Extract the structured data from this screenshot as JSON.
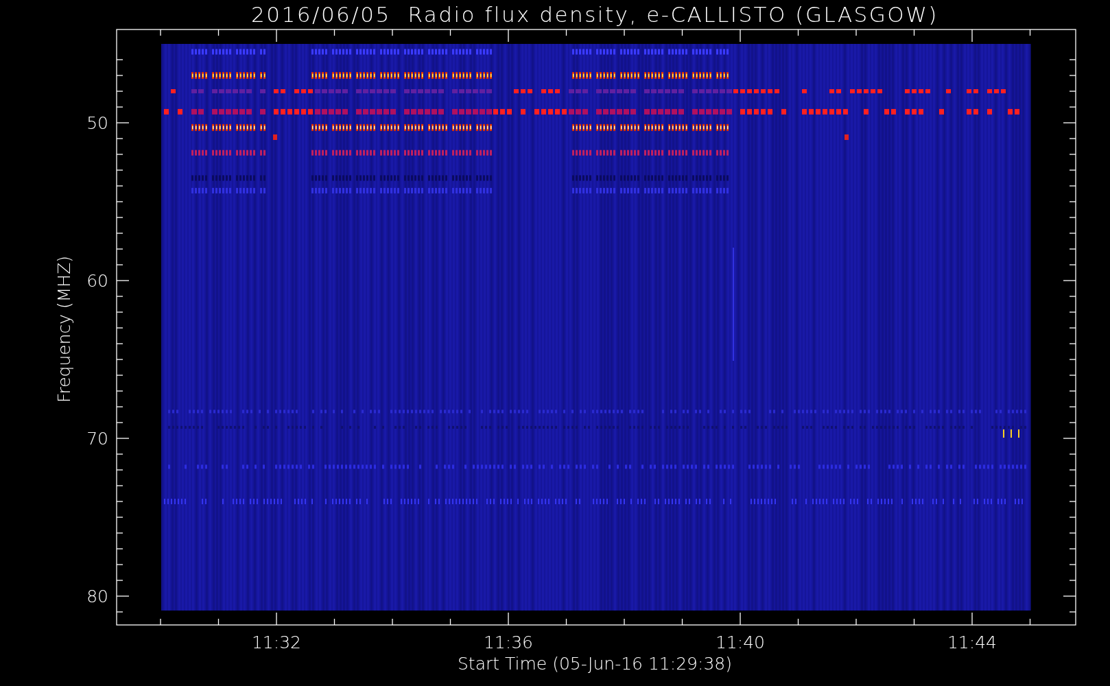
{
  "title": "2016/06/05  Radio flux density, e-CALLISTO (GLASGOW)",
  "y_axis": {
    "label": "Frequency (MHZ)",
    "ticks": [
      "50",
      "60",
      "70",
      "80"
    ]
  },
  "x_axis": {
    "label": "Start Time (05-Jun-16 11:29:38)",
    "ticks": [
      "11:32",
      "11:36",
      "11:40",
      "11:44"
    ]
  }
}
